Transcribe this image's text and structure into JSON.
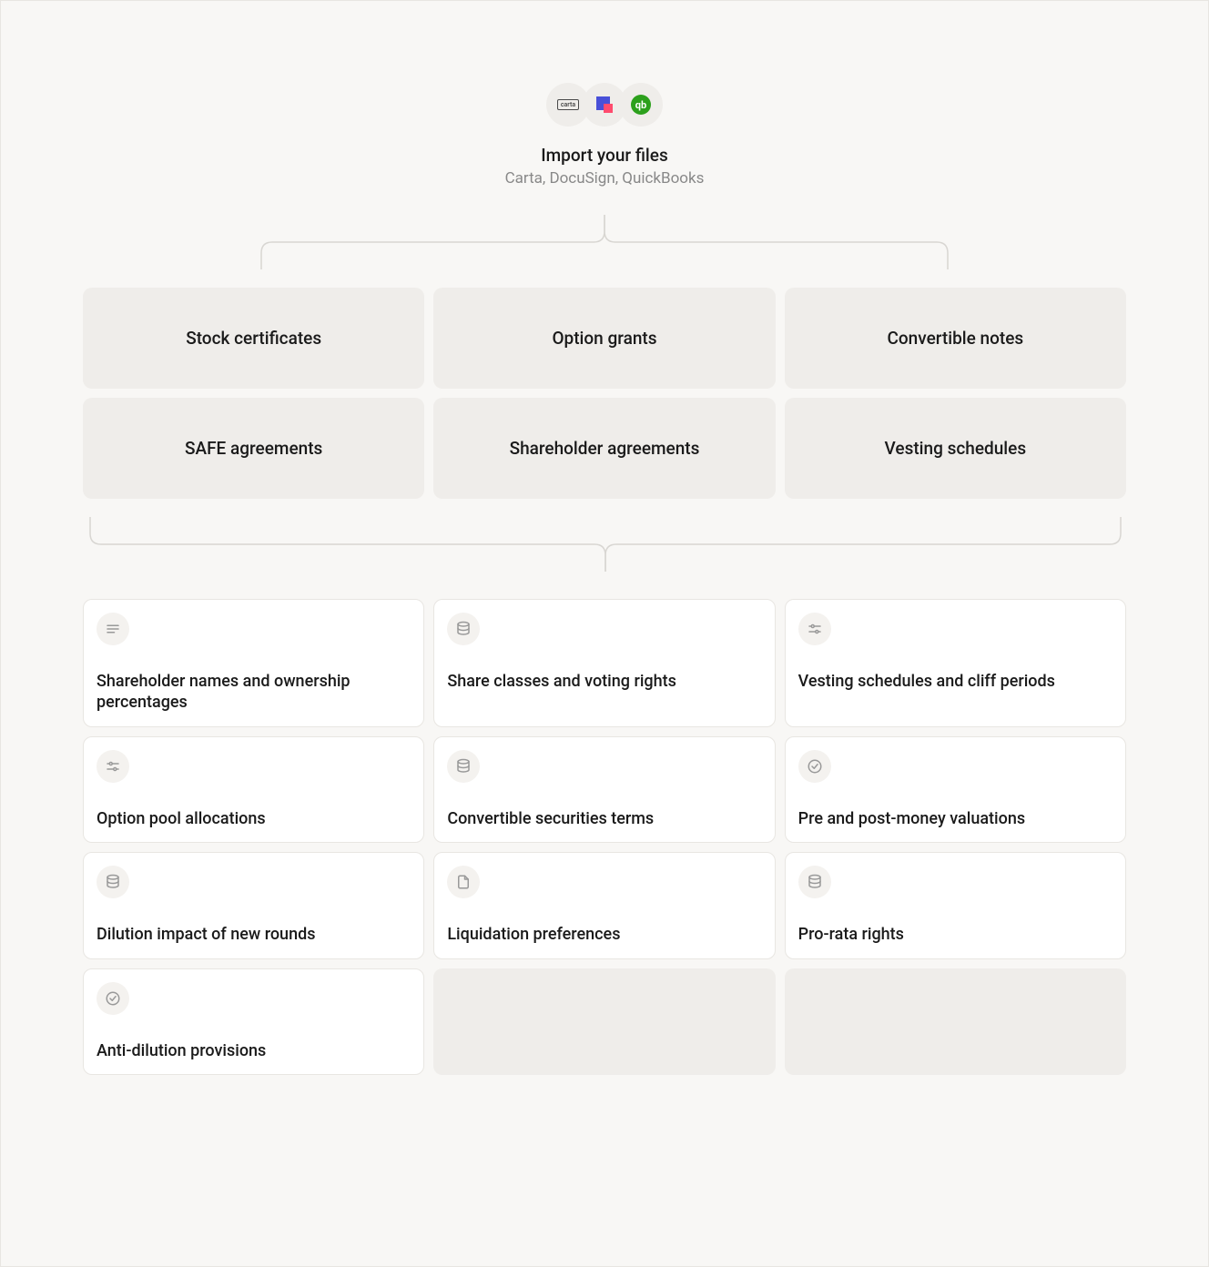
{
  "header": {
    "title": "Import your files",
    "subtitle": "Carta, DocuSign, QuickBooks",
    "logos": [
      "carta",
      "docusign",
      "quickbooks"
    ]
  },
  "doc_types": [
    "Stock certificates",
    "Option grants",
    "Convertible notes",
    "SAFE agreements",
    "Shareholder agreements",
    "Vesting schedules"
  ],
  "extracted_info": [
    {
      "icon": "lines",
      "label": "Shareholder names and ownership percentages"
    },
    {
      "icon": "database",
      "label": "Share classes and voting rights"
    },
    {
      "icon": "sliders",
      "label": "Vesting schedules and cliff periods"
    },
    {
      "icon": "sliders",
      "label": "Option pool allocations"
    },
    {
      "icon": "database",
      "label": "Convertible securities terms"
    },
    {
      "icon": "check-circle",
      "label": "Pre and post-money valuations"
    },
    {
      "icon": "database",
      "label": "Dilution impact of new rounds"
    },
    {
      "icon": "file",
      "label": "Liquidation preferences"
    },
    {
      "icon": "database",
      "label": "Pro-rata rights"
    },
    {
      "icon": "check-circle",
      "label": "Anti-dilution provisions"
    },
    {
      "icon": "",
      "label": ""
    },
    {
      "icon": "",
      "label": ""
    }
  ]
}
